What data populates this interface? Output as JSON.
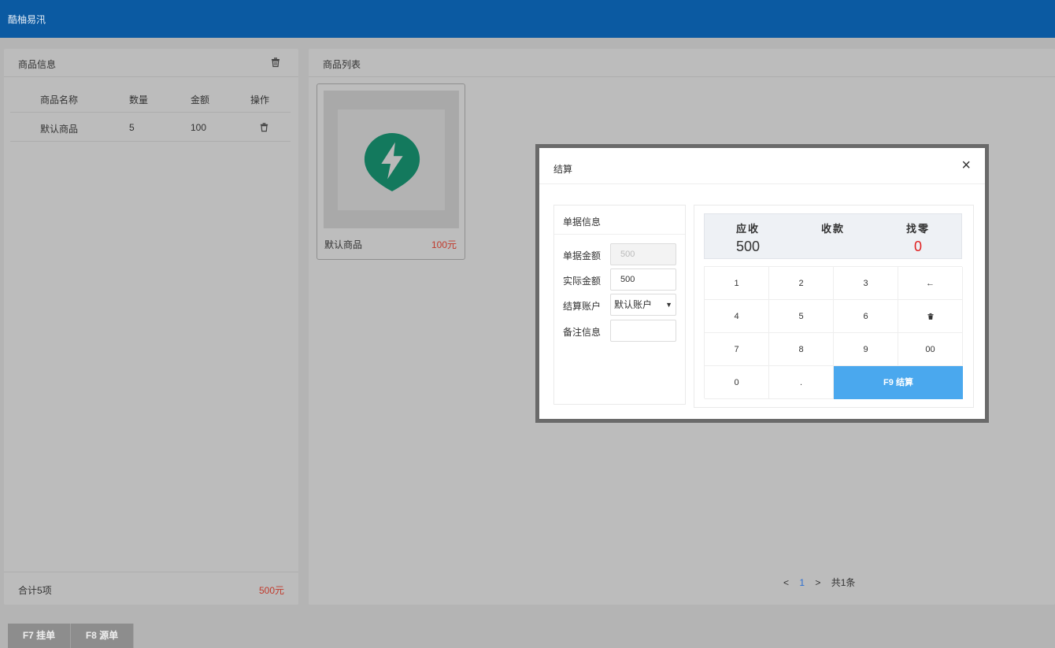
{
  "app": {
    "title": "酷柚易汛"
  },
  "cart": {
    "title": "商品信息",
    "headers": {
      "name": "商品名称",
      "qty": "数量",
      "amount": "金额",
      "op": "操作"
    },
    "rows": [
      {
        "name": "默认商品",
        "qty": "5",
        "amount": "100"
      }
    ],
    "total_count": "合计5项",
    "total_amount": "500元"
  },
  "products": {
    "title": "商品列表",
    "items": [
      {
        "name": "默认商品",
        "price": "100元"
      }
    ],
    "pager": {
      "prev": "<",
      "current": "1",
      "next": ">",
      "total": "共1条"
    }
  },
  "bottom": {
    "hold": "F7 挂单",
    "orders": "F8 源单"
  },
  "modal": {
    "title": "结算",
    "close": "×",
    "doc": {
      "title": "单据信息",
      "fields": [
        {
          "label": "单据金额",
          "value": "500"
        },
        {
          "label": "实际金额",
          "value": "500"
        },
        {
          "label": "结算账户",
          "value": "默认账户"
        },
        {
          "label": "备注信息",
          "value": ""
        }
      ]
    },
    "summary": {
      "due_label": "应收",
      "due_value": "500",
      "received_label": "收款",
      "change_label": "找零",
      "change_value": "0"
    },
    "keys": [
      "1",
      "2",
      "3",
      "←",
      "4",
      "5",
      "6",
      "🗑",
      "7",
      "8",
      "9",
      "00",
      "0",
      ".",
      "F9 结算"
    ]
  },
  "colors": {
    "header": "#0b5aa2",
    "accent": "#4aa8ee",
    "danger": "#e02020"
  },
  "icons": {
    "trash": "trash-icon",
    "lightning": "lightning-logo-icon",
    "close": "close-icon"
  }
}
